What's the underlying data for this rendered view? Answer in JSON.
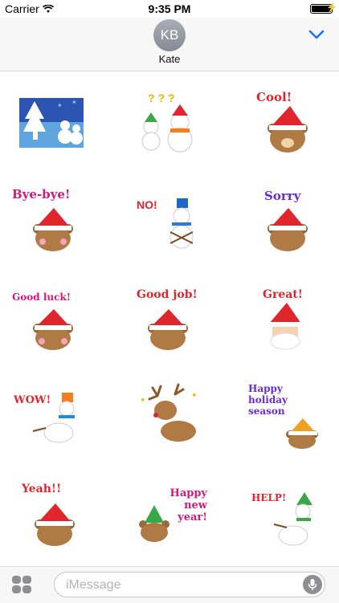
{
  "status": {
    "carrier": "Carrier",
    "time": "9:35 PM"
  },
  "header": {
    "avatar_initials": "KB",
    "contact_name": "Kate"
  },
  "stickers": [
    {
      "label": ""
    },
    {
      "label": "? ? ?"
    },
    {
      "label": "Cool!"
    },
    {
      "label": "Bye-bye!"
    },
    {
      "label": "NO!"
    },
    {
      "label": "Sorry"
    },
    {
      "label": "Good luck!"
    },
    {
      "label": "Good job!"
    },
    {
      "label": "Great!"
    },
    {
      "label": "WOW!"
    },
    {
      "label": ""
    },
    {
      "label": "Happy holiday season"
    },
    {
      "label": "Yeah!!"
    },
    {
      "label": "Happy new year!"
    },
    {
      "label": "HELP!"
    }
  ],
  "compose": {
    "placeholder": "iMessage"
  },
  "icons": {
    "status": [
      "wifi-icon",
      "battery-icon",
      "charging-bolt-icon"
    ],
    "header": [
      "chevron-down-icon"
    ],
    "bottom": [
      "app-drawer-icon",
      "microphone-icon"
    ]
  },
  "colors": {
    "accent": "#1a73e8",
    "pink_label": "#d6177b",
    "red_label": "#e0252c",
    "purple_label": "#6a2bd6"
  }
}
